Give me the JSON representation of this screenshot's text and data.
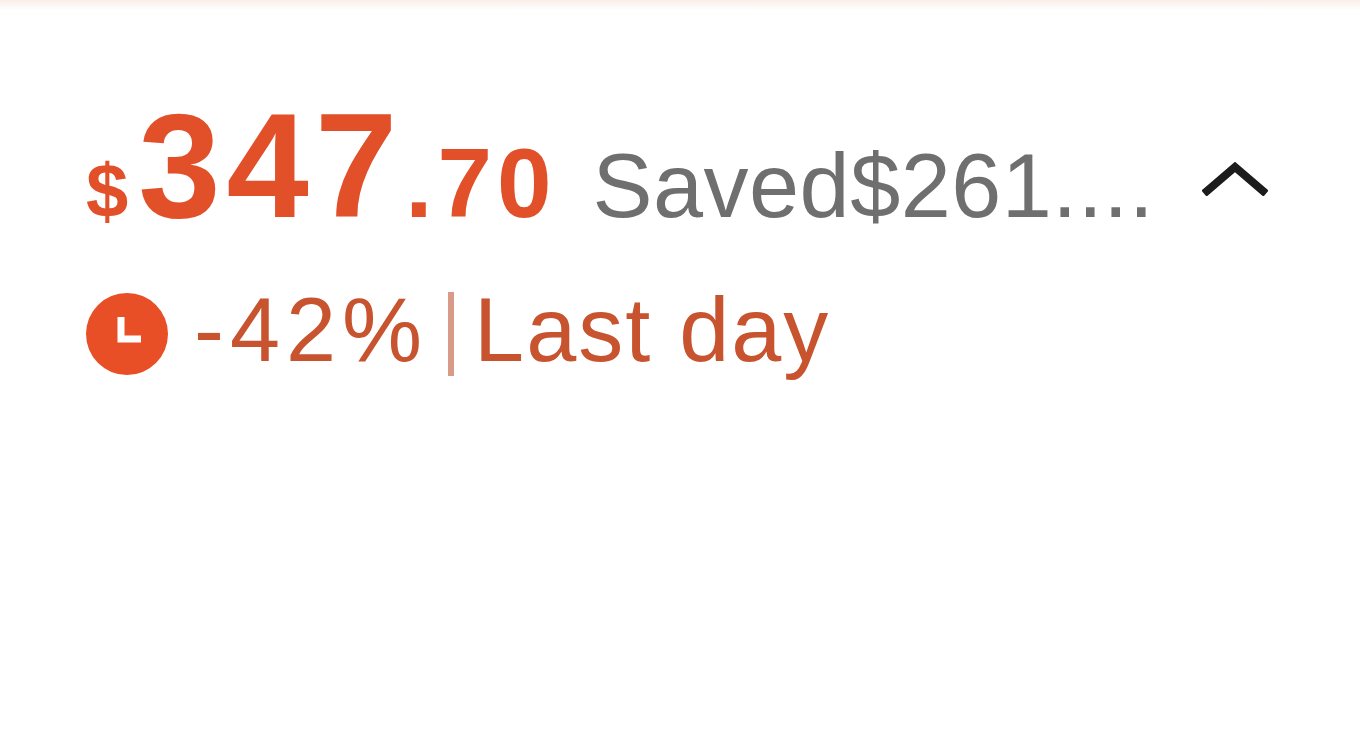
{
  "price": {
    "currency": "$",
    "whole": "347",
    "fraction": ".70",
    "savings": "Saved$261....",
    "expanded": true
  },
  "deal": {
    "discount": "-42%",
    "label": "Last day"
  }
}
